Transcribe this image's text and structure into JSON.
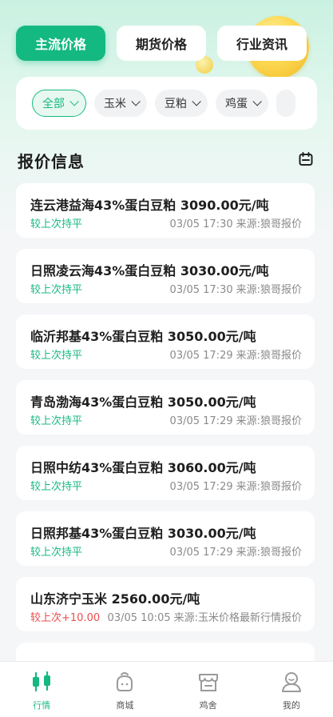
{
  "top_tabs": [
    {
      "label": "主流价格",
      "active": true
    },
    {
      "label": "期货价格",
      "active": false
    },
    {
      "label": "行业资讯",
      "active": false
    }
  ],
  "filters": [
    {
      "label": "全部",
      "active": true
    },
    {
      "label": "玉米",
      "active": false
    },
    {
      "label": "豆粕",
      "active": false
    },
    {
      "label": "鸡蛋",
      "active": false
    },
    {
      "label": "",
      "active": false
    }
  ],
  "section": {
    "title": "报价信息",
    "calendar_icon": "calendar-icon"
  },
  "quotes": [
    {
      "title": "连云港益海43%蛋白豆粕 3090.00元/吨",
      "change": "较上次持平",
      "change_type": "flat",
      "time": "03/05 17:30",
      "source": "来源:狼哥报价"
    },
    {
      "title": "日照凌云海43%蛋白豆粕 3030.00元/吨",
      "change": "较上次持平",
      "change_type": "flat",
      "time": "03/05 17:30",
      "source": "来源:狼哥报价"
    },
    {
      "title": "临沂邦基43%蛋白豆粕 3050.00元/吨",
      "change": "较上次持平",
      "change_type": "flat",
      "time": "03/05 17:29",
      "source": "来源:狼哥报价"
    },
    {
      "title": "青岛渤海43%蛋白豆粕 3050.00元/吨",
      "change": "较上次持平",
      "change_type": "flat",
      "time": "03/05 17:29",
      "source": "来源:狼哥报价"
    },
    {
      "title": "日照中纺43%蛋白豆粕 3060.00元/吨",
      "change": "较上次持平",
      "change_type": "flat",
      "time": "03/05 17:29",
      "source": "来源:狼哥报价"
    },
    {
      "title": "日照邦基43%蛋白豆粕 3030.00元/吨",
      "change": "较上次持平",
      "change_type": "flat",
      "time": "03/05 17:29",
      "source": "来源:狼哥报价"
    },
    {
      "title": "山东济宁玉米 2560.00元/吨",
      "change": "较上次+10.00",
      "change_type": "up",
      "time": "03/05 10:05",
      "source": "来源:玉米价格最新行情报价"
    }
  ],
  "bottom_nav": [
    {
      "label": "行情",
      "icon": "market-icon",
      "active": true
    },
    {
      "label": "商城",
      "icon": "mall-bag-icon",
      "active": false
    },
    {
      "label": "鸡舍",
      "icon": "shop-icon",
      "active": false
    },
    {
      "label": "我的",
      "icon": "profile-icon",
      "active": false
    }
  ],
  "colors": {
    "accent": "#14b981",
    "up": "#ee4b4b"
  }
}
